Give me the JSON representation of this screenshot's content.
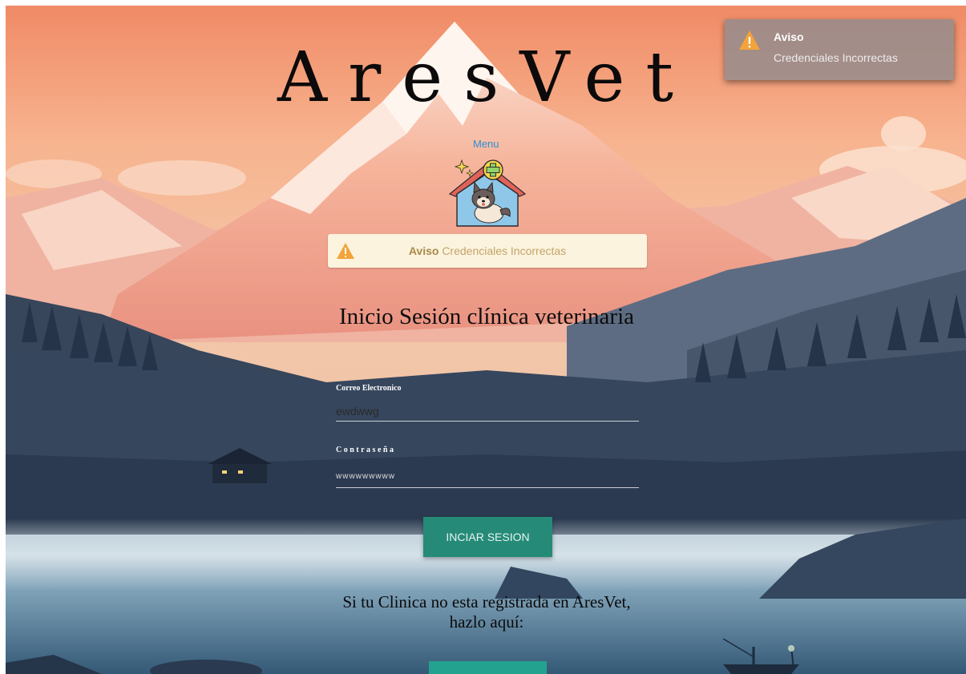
{
  "app": {
    "brand": "AresVet"
  },
  "toast": {
    "title": "Aviso",
    "message": "Credenciales Incorrectas",
    "icon": "warning-icon"
  },
  "nav": {
    "menu_label": "Menu"
  },
  "alert": {
    "title": "Aviso",
    "message": "Credenciales Incorrectas",
    "icon": "warning-icon",
    "bg_color": "#fbf3de"
  },
  "login": {
    "heading": "Inicio Sesión clínica veterinaria",
    "email_label": "Correo Electronico",
    "email_value": "ewdwwg",
    "password_label": "Contraseña",
    "password_value": "wwwwwwwww",
    "submit_label": "INCIAR SESION"
  },
  "register": {
    "prompt": "Si tu Clinica no esta registrada en AresVet, hazlo aquí:"
  },
  "colors": {
    "accent": "#258b78",
    "warning": "#f2a33a",
    "link": "#2a8fd6"
  }
}
